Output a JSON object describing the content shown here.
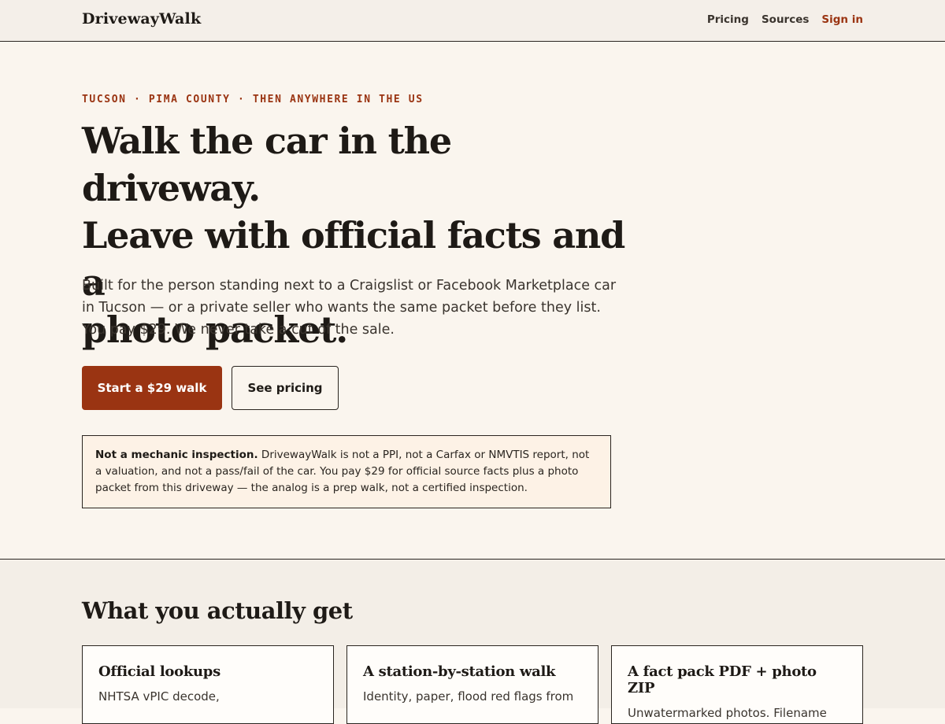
{
  "header": {
    "brand": "DrivewayWalk",
    "nav": [
      {
        "label": "Pricing"
      },
      {
        "label": "Sources"
      },
      {
        "label": "Sign in"
      }
    ]
  },
  "hero": {
    "eyebrow": "TUCSON · PIMA COUNTY · THEN ANYWHERE IN THE US",
    "headline_lines": [
      "Walk the car in the driveway.",
      "Leave with official facts and a",
      "photo packet."
    ],
    "lede": "Built for the person standing next to a Craigslist or Facebook Marketplace car in Tucson — or a private seller who wants the same packet before they list. You pay $29. We never take a cut of the sale.",
    "primary_cta": "Start a $29 walk",
    "secondary_cta": "See pricing",
    "notice": {
      "lead": "Not a mechanic inspection.",
      "text": "DrivewayWalk is not a PPI, not a Carfax or NMVTIS report, not a valuation, and not a pass/fail of the car. You pay $29 for official source facts plus a photo packet from this driveway — the analog is a prep walk, not a certified inspection."
    }
  },
  "features": {
    "title": "What you actually get",
    "cards": [
      {
        "title": "Official lookups",
        "body": "NHTSA vPIC decode,"
      },
      {
        "title": "A station-by-station walk",
        "body": "Identity, paper, flood red flags from"
      },
      {
        "title": "A fact pack PDF + photo ZIP",
        "body": "Unwatermarked photos. Filename"
      }
    ]
  },
  "colors": {
    "accent": "#9a3412",
    "background": "#faf5ee",
    "ink": "#1e1a16"
  }
}
